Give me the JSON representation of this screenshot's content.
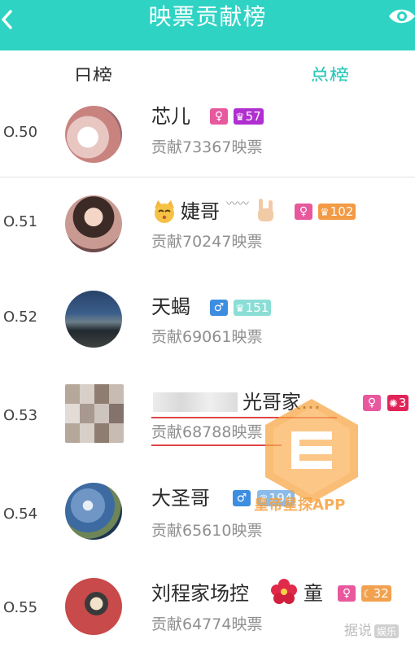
{
  "header": {
    "title": "映票贡献榜",
    "back_icon": "chevron-left-icon",
    "eye_icon": "eye-icon",
    "color": "#2fd3c3"
  },
  "tabs": [
    {
      "label": "日榜",
      "active": false
    },
    {
      "label": "总榜",
      "active": true
    }
  ],
  "rows": [
    {
      "rank": "O.50",
      "name": "芯儿",
      "gender": "female",
      "level": "57",
      "contribution": "贡献73367映票"
    },
    {
      "rank": "O.51",
      "name": "婕哥",
      "name_deco": "〰〰",
      "gender": "female",
      "level": "102",
      "contribution": "贡献70247映票"
    },
    {
      "rank": "O.52",
      "name": "天蝎",
      "gender": "male",
      "level": "151",
      "contribution": "贡献69061映票"
    },
    {
      "rank": "O.53",
      "name": "光哥家…",
      "gender": "female",
      "level": "3",
      "contribution": "贡献68788映票"
    },
    {
      "rank": "O.54",
      "name": "大圣哥",
      "gender": "male",
      "level": "194",
      "contribution": "贡献65610映票"
    },
    {
      "rank": "O.55",
      "name": "刘程家场控",
      "name_suffix": "童",
      "gender": "female",
      "level": "32",
      "contribution": "贡献64774映票"
    }
  ],
  "watermark": {
    "text": "皇帝星探APP"
  },
  "corner_logo": {
    "text": "据说",
    "box": "娱乐"
  },
  "symbols": {
    "female": "♀",
    "male": "♂",
    "crown": "♛"
  }
}
